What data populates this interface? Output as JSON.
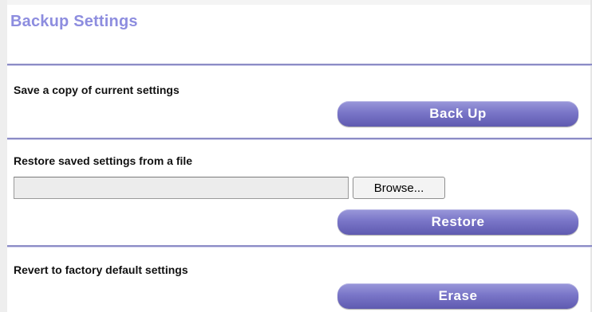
{
  "page": {
    "title": "Backup Settings"
  },
  "backup_section": {
    "label": "Save a copy of current settings",
    "button_label": "Back Up"
  },
  "restore_section": {
    "label": "Restore saved settings from a file",
    "file_value": "",
    "browse_label": "Browse...",
    "button_label": "Restore"
  },
  "erase_section": {
    "label": "Revert to factory default settings",
    "button_label": "Erase"
  },
  "colors": {
    "title": "#8d8ddf",
    "rule": "#8c8cc6",
    "button": "#7a76c8"
  }
}
